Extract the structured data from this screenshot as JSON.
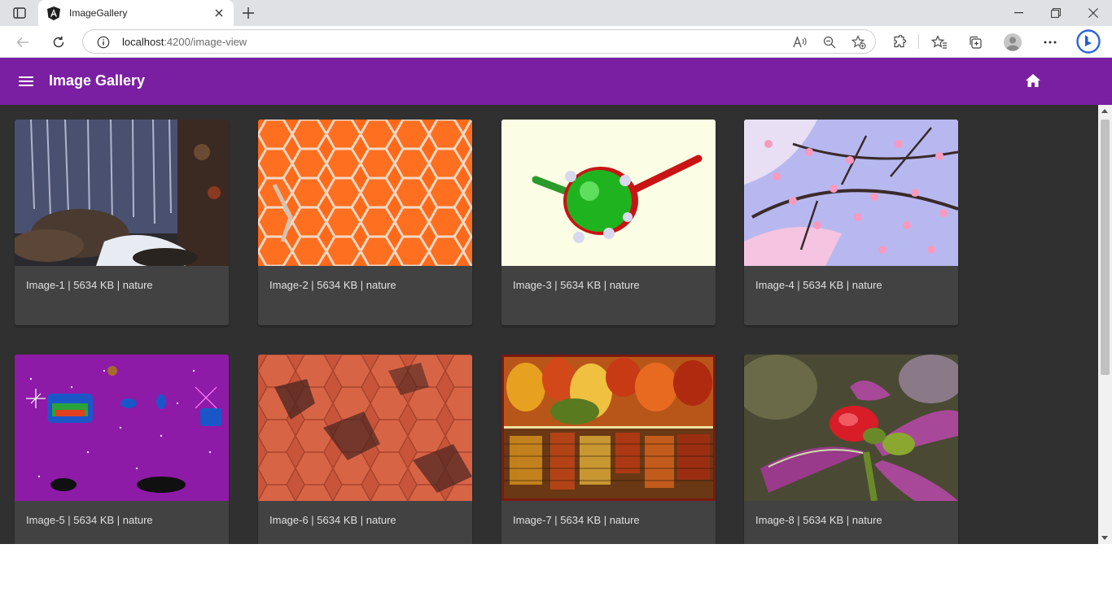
{
  "browser": {
    "tab_title": "ImageGallery",
    "url_host": "localhost",
    "url_path": ":4200/image-view"
  },
  "app": {
    "title": "Image Gallery",
    "accent": "#7b1fa2",
    "background": "#303030",
    "card_color": "#424242"
  },
  "gallery": {
    "images": [
      {
        "caption": "Image-1 | 5634 KB | nature",
        "depicts": "waterfall over rocks"
      },
      {
        "caption": "Image-2 | 5634 KB | nature",
        "depicts": "orange hexagon tiles"
      },
      {
        "caption": "Image-3 | 5634 KB | nature",
        "depicts": "green molecule model with red rods"
      },
      {
        "caption": "Image-4 | 5634 KB | nature",
        "depicts": "pink cherry blossom branch"
      },
      {
        "caption": "Image-5 | 5634 KB | nature",
        "depicts": "purple sparkle pattern with jewels"
      },
      {
        "caption": "Image-6 | 5634 KB | nature",
        "depicts": "3d terracotta hexagon blocks"
      },
      {
        "caption": "Image-7 | 5634 KB | nature",
        "depicts": "autumn forest reflected in lake"
      },
      {
        "caption": "Image-8 | 5634 KB | nature",
        "depicts": "red flower bud with purple leaves"
      }
    ]
  }
}
